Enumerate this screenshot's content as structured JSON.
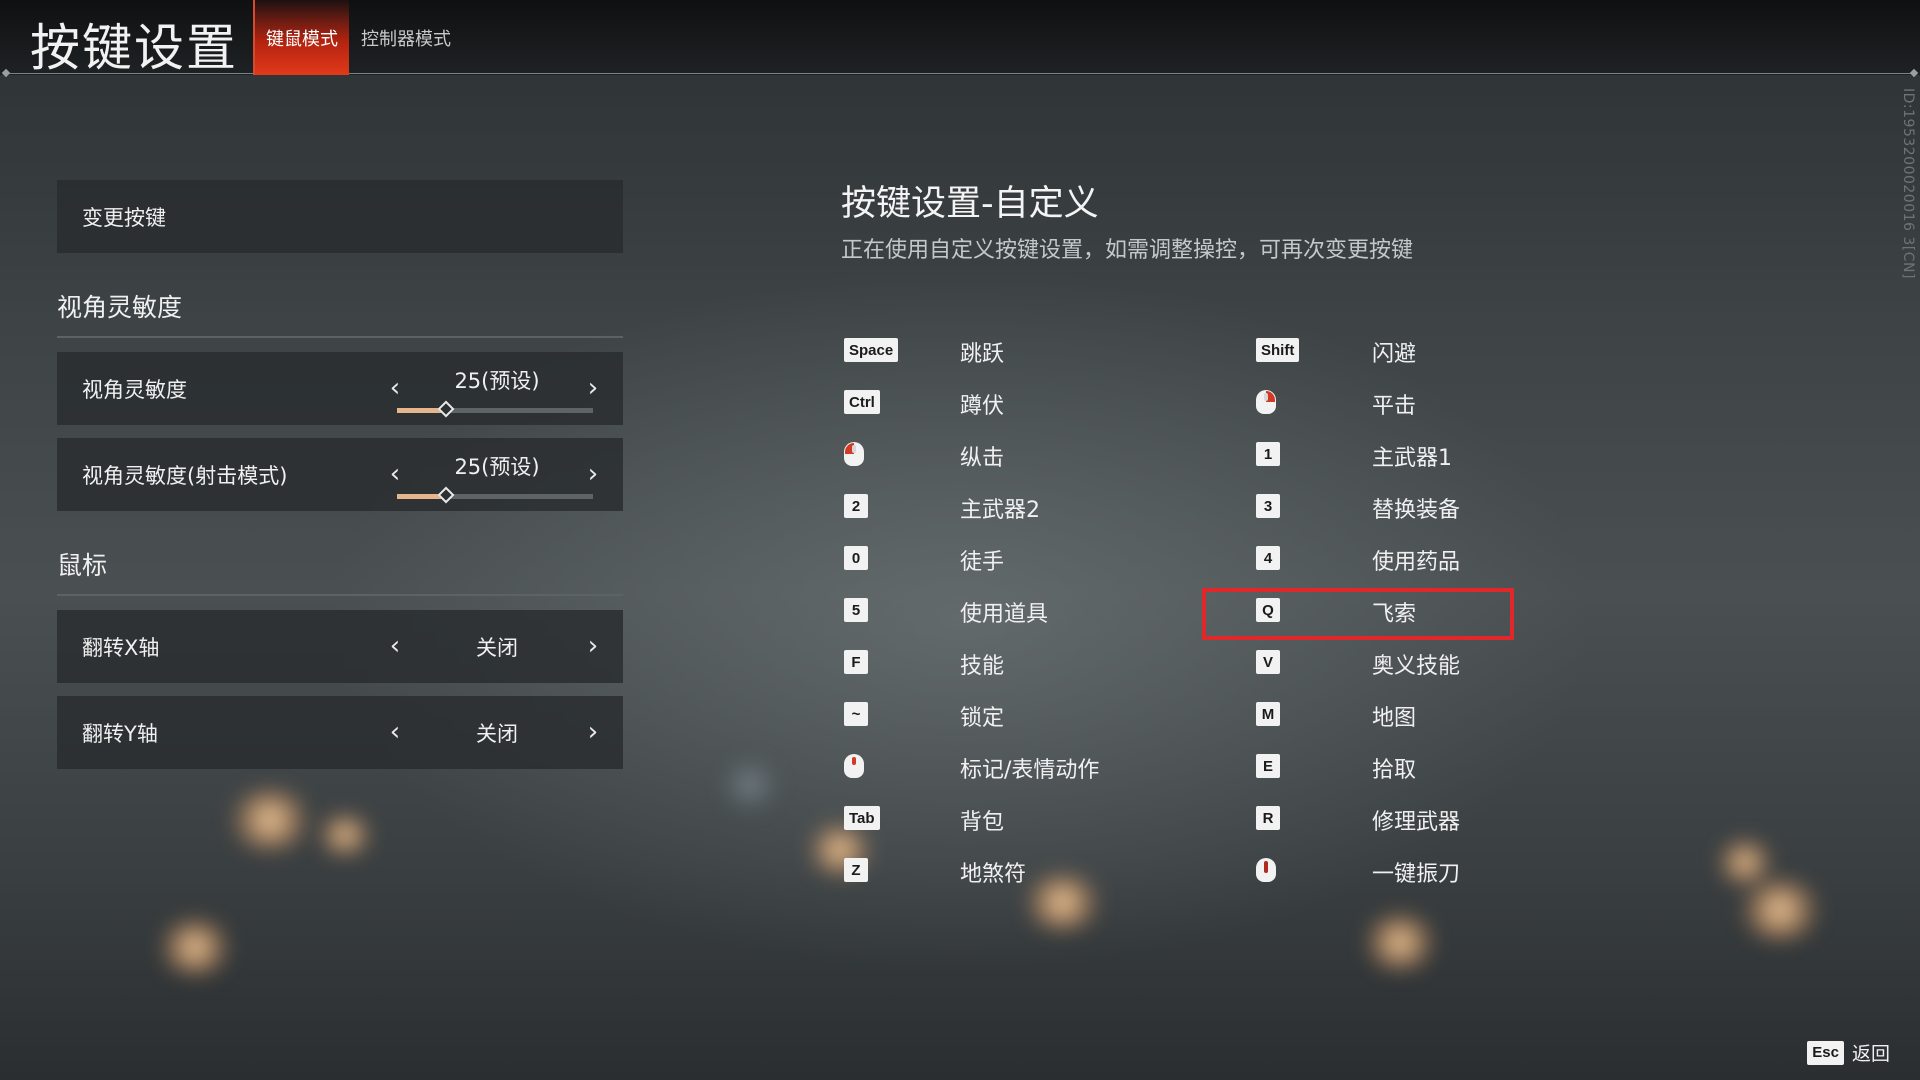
{
  "header": {
    "title": "按键设置",
    "tabs": [
      {
        "label": "键鼠模式",
        "active": true
      },
      {
        "label": "控制器模式",
        "active": false
      }
    ],
    "build_id": "ID:1953200020016 3[CN]"
  },
  "left_panel": {
    "change_keys_label": "变更按键",
    "sections": [
      {
        "title": "视角灵敏度",
        "rows": [
          {
            "label": "视角灵敏度",
            "value": "25(预设)",
            "slider_fraction": 0.25
          },
          {
            "label": "视角灵敏度(射击模式)",
            "value": "25(预设)",
            "slider_fraction": 0.25
          }
        ]
      },
      {
        "title": "鼠标",
        "rows": [
          {
            "label": "翻转X轴",
            "value": "关闭"
          },
          {
            "label": "翻转Y轴",
            "value": "关闭"
          }
        ]
      }
    ]
  },
  "right_panel": {
    "title": "按键设置-自定义",
    "subtitle": "正在使用自定义按键设置，如需调整操控，可再次变更按键",
    "bindings_left": [
      {
        "key": "Space",
        "action": "跳跃"
      },
      {
        "key": "Ctrl",
        "action": "蹲伏"
      },
      {
        "key": "mouse-left-click",
        "action": "纵击",
        "icon": true
      },
      {
        "key": "2",
        "action": "主武器2"
      },
      {
        "key": "0",
        "action": "徒手"
      },
      {
        "key": "5",
        "action": "使用道具"
      },
      {
        "key": "F",
        "action": "技能"
      },
      {
        "key": "~",
        "action": "锁定"
      },
      {
        "key": "mouse-middle-click",
        "action": "标记/表情动作",
        "icon": true
      },
      {
        "key": "Tab",
        "action": "背包"
      },
      {
        "key": "Z",
        "action": "地煞符"
      }
    ],
    "bindings_right": [
      {
        "key": "Shift",
        "action": "闪避"
      },
      {
        "key": "mouse-right-click",
        "action": "平击",
        "icon": true
      },
      {
        "key": "1",
        "action": "主武器1"
      },
      {
        "key": "3",
        "action": "替换装备"
      },
      {
        "key": "4",
        "action": "使用药品"
      },
      {
        "key": "Q",
        "action": "飞索"
      },
      {
        "key": "V",
        "action": "奥义技能"
      },
      {
        "key": "M",
        "action": "地图"
      },
      {
        "key": "E",
        "action": "拾取"
      },
      {
        "key": "R",
        "action": "修理武器"
      },
      {
        "key": "mouse-scroll-click",
        "action": "一键振刀",
        "icon": true
      }
    ],
    "highlighted_action": "飞索"
  },
  "footer": {
    "esc_key": "Esc",
    "back_label": "返回"
  },
  "colors": {
    "accent": "#e2391a",
    "highlight": "#e0282a",
    "slider_fill": "#e6b58c"
  }
}
